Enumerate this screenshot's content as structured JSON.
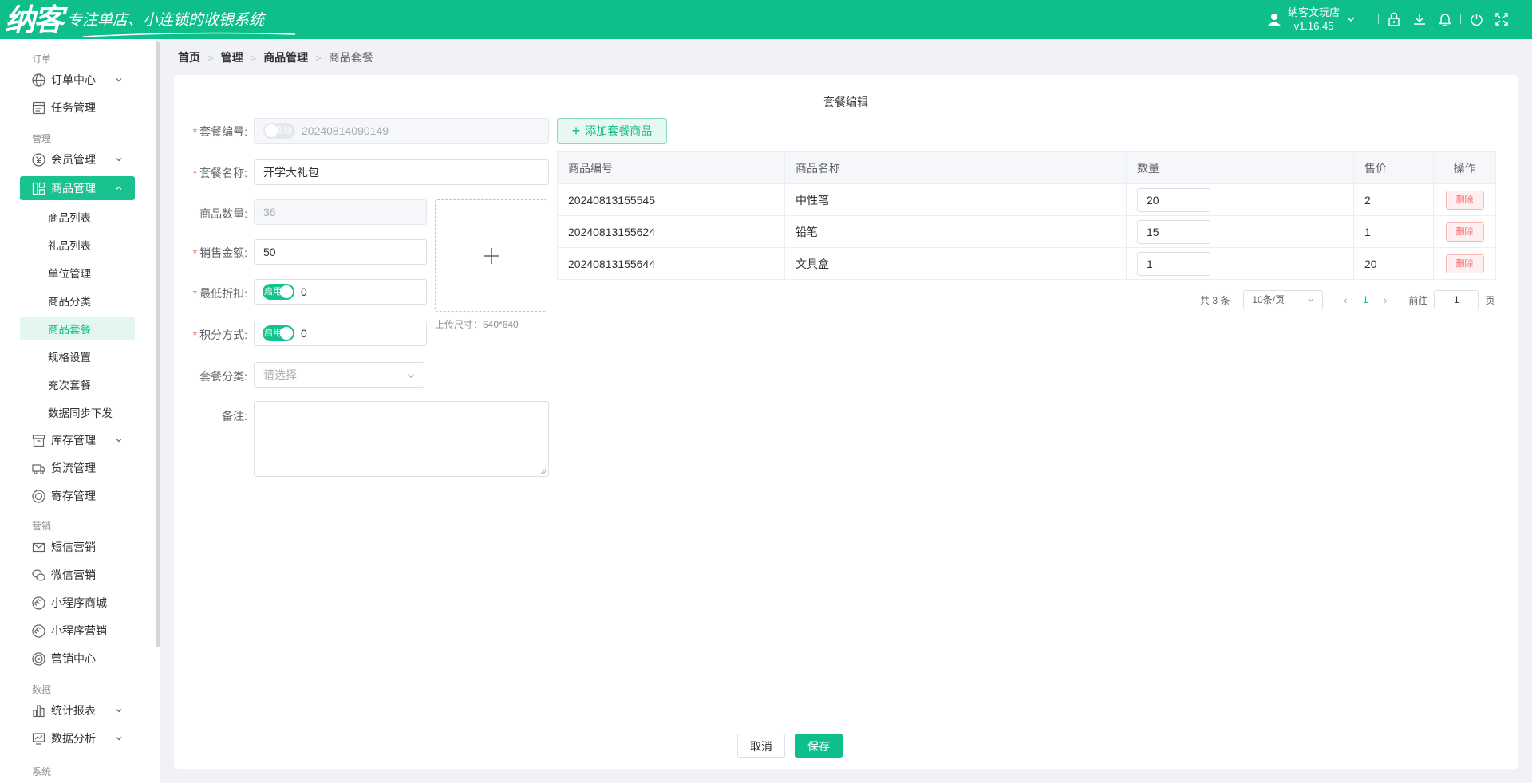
{
  "header": {
    "logo_mark": "纳客",
    "slogan": "专注单店、小连锁的收银系统",
    "store_name": "纳客文玩店",
    "version": "v1.16.45",
    "brand_color": "#0ebf8c"
  },
  "sidebar": {
    "groups": {
      "order": "订单",
      "manage": "管理",
      "marketing": "营销",
      "data": "数据",
      "system": "系统"
    },
    "items": {
      "order_center": "订单中心",
      "task_manage": "任务管理",
      "member_manage": "会员管理",
      "goods_manage": "商品管理",
      "stock_manage": "库存管理",
      "logistics_manage": "货流管理",
      "deposit_manage": "寄存管理",
      "sms_marketing": "短信营销",
      "wechat_marketing": "微信营销",
      "mini_mall": "小程序商城",
      "mini_marketing": "小程序营销",
      "marketing_center": "营销中心",
      "stats_report": "统计报表",
      "data_analysis": "数据分析"
    },
    "goods_sub": {
      "goods_list": "商品列表",
      "gift_list": "礼品列表",
      "unit_manage": "单位管理",
      "goods_category": "商品分类",
      "goods_package": "商品套餐",
      "spec_setting": "规格设置",
      "recharge_package": "充次套餐",
      "data_sync": "数据同步下发"
    }
  },
  "breadcrumb": {
    "home": "首页",
    "manage": "管理",
    "goods_manage": "商品管理",
    "current": "商品套餐"
  },
  "form": {
    "title": "套餐编辑",
    "code_label": "套餐编号:",
    "code_toggle_text": "自动",
    "code_value": "20240814090149",
    "name_label": "套餐名称:",
    "name_value": "开学大礼包",
    "count_label": "商品数量:",
    "count_value": "36",
    "price_label": "销售金额:",
    "price_value": "50",
    "discount_label": "最低折扣:",
    "discount_toggle_text": "启用",
    "discount_value": "0",
    "points_label": "积分方式:",
    "points_toggle_text": "启用",
    "points_value": "0",
    "category_label": "套餐分类:",
    "category_placeholder": "请选择",
    "remark_label": "备注:",
    "upload_hint": "上传尺寸：640*640",
    "add_button": "添加套餐商品"
  },
  "table": {
    "headers": [
      "商品编号",
      "商品名称",
      "数量",
      "售价",
      "操作"
    ],
    "rows": [
      {
        "code": "20240813155545",
        "name": "中性笔",
        "qty": "20",
        "price": "2",
        "action": "删除"
      },
      {
        "code": "20240813155624",
        "name": "铅笔",
        "qty": "15",
        "price": "1",
        "action": "删除"
      },
      {
        "code": "20240813155644",
        "name": "文具盒",
        "qty": "1",
        "price": "20",
        "action": "删除"
      }
    ]
  },
  "pagination": {
    "total": "共 3 条",
    "page_size": "10条/页",
    "current_page": "1",
    "goto_label": "前往",
    "goto_value": "1",
    "page_suffix": "页"
  },
  "footer": {
    "cancel": "取消",
    "save": "保存"
  }
}
